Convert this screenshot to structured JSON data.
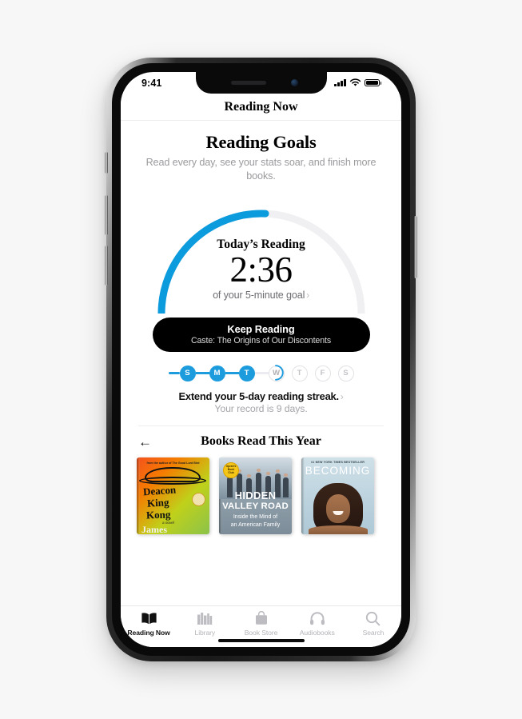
{
  "device": {
    "status_bar": {
      "time": "9:41",
      "cellular_icon": "signal-bars-icon",
      "wifi_icon": "wifi-icon",
      "battery_icon": "battery-icon"
    },
    "home_indicator": "home-indicator"
  },
  "navbar": {
    "title": "Reading Now"
  },
  "goals": {
    "title": "Reading Goals",
    "subtitle": "Read every day, see your stats soar, and finish more books."
  },
  "progress_ring": {
    "today_label": "Today’s Reading",
    "time_value": "2:36",
    "goal_text": "of your 5-minute goal",
    "chevron": "›",
    "track_color": "#f0f0f3",
    "fill_color": "#0c9bdc",
    "percent_complete": 52
  },
  "keep_reading": {
    "title": "Keep Reading",
    "subtitle": "Caste: The Origins of Our Discontents",
    "background_color": "#000000"
  },
  "streak": {
    "days": [
      {
        "label": "S",
        "state": "done"
      },
      {
        "label": "M",
        "state": "done"
      },
      {
        "label": "T",
        "state": "done"
      },
      {
        "label": "W",
        "state": "current"
      },
      {
        "label": "T",
        "state": "todo"
      },
      {
        "label": "F",
        "state": "todo"
      },
      {
        "label": "S",
        "state": "todo"
      }
    ],
    "accent_color": "#1c9bdd",
    "main_text": "Extend your 5-day reading streak.",
    "chevron": "›",
    "record_text": "Your record is 9 days."
  },
  "books_section": {
    "back_icon": "back-arrow-icon",
    "back_glyph": "←",
    "title": "Books Read This Year",
    "books": [
      {
        "title_line1": "Deacon",
        "title_line2": "King",
        "title_line3": "Kong",
        "author": "James",
        "top_blurb": "from the author of The Good Lord Bird",
        "novel_label": "a novel",
        "badge": "book-club-seal-icon"
      },
      {
        "title_line1": "HIDDEN",
        "title_line2": "VALLEY ROAD",
        "subtitle_line1": "Inside the Mind of",
        "subtitle_line2": "an American Family",
        "badge_text": "Oprah’s Book Club"
      },
      {
        "kicker": "#1 NEW YORK TIMES BESTSELLER",
        "title": "BECOMING"
      }
    ]
  },
  "tabbar": {
    "tabs": [
      {
        "label": "Reading Now",
        "icon": "open-book-icon",
        "active": true
      },
      {
        "label": "Library",
        "icon": "books-shelf-icon",
        "active": false
      },
      {
        "label": "Book Store",
        "icon": "shopping-bag-icon",
        "active": false
      },
      {
        "label": "Audiobooks",
        "icon": "headphones-icon",
        "active": false
      },
      {
        "label": "Search",
        "icon": "search-icon",
        "active": false
      }
    ]
  }
}
